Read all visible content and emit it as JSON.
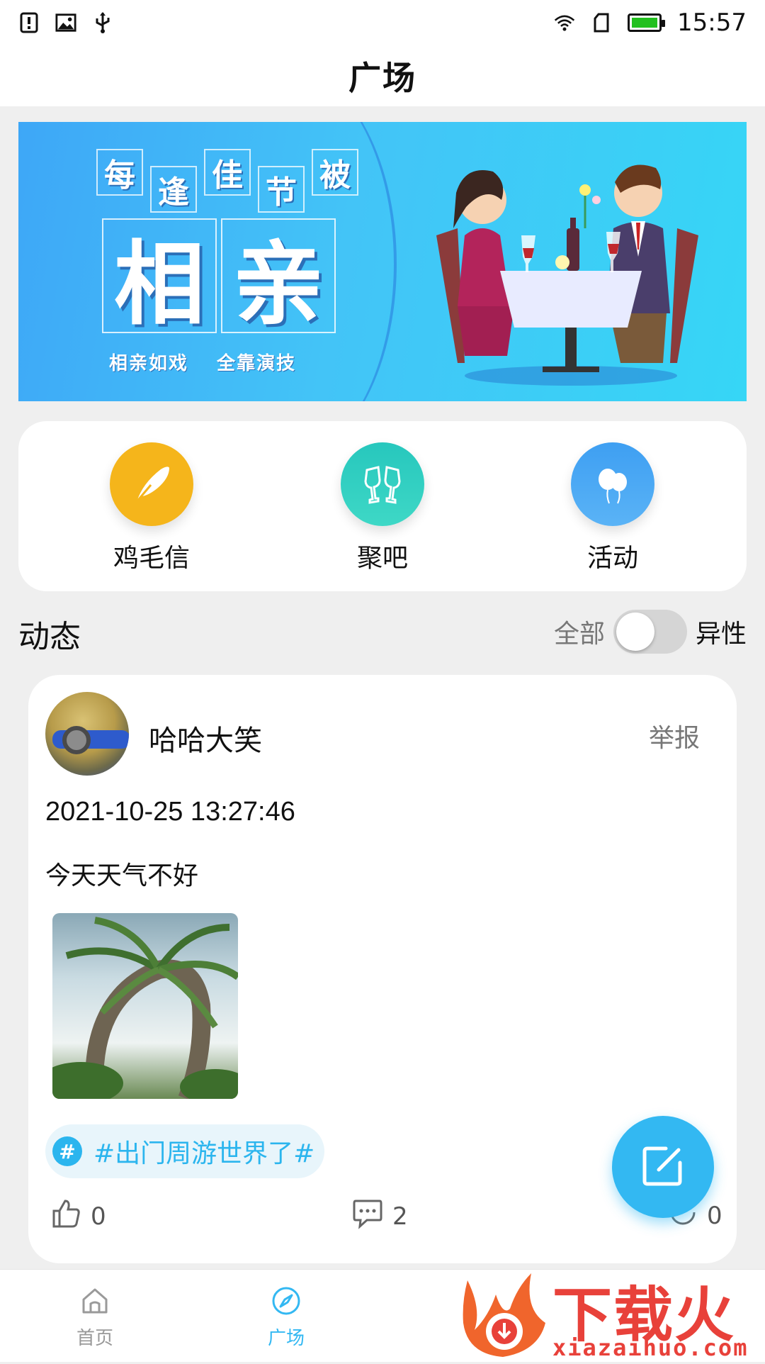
{
  "status_bar": {
    "time": "15:57"
  },
  "header": {
    "title": "广场"
  },
  "banner": {
    "top_chars": [
      "每",
      "逢",
      "佳",
      "节",
      "被"
    ],
    "main_chars": [
      "相",
      "亲"
    ],
    "subtitles": [
      "相亲如戏",
      "全靠演技"
    ]
  },
  "quick_menu": {
    "items": [
      {
        "label": "鸡毛信",
        "icon": "feather-icon",
        "color": "#f5b51b"
      },
      {
        "label": "聚吧",
        "icon": "cheers-glasses-icon",
        "color": "#2fd0c0"
      },
      {
        "label": "活动",
        "icon": "balloons-icon",
        "color": "#3aa0f2"
      }
    ]
  },
  "feed": {
    "section_title": "动态",
    "filter": {
      "left_label": "全部",
      "right_label": "异性",
      "toggle_on": false
    }
  },
  "post": {
    "username": "哈哈大笑",
    "report_label": "举报",
    "time": "2021-10-25 13:27:46",
    "text": "今天天气不好",
    "tag": "#出门周游世界了#",
    "likes": "0",
    "comments": "2",
    "shares": "0"
  },
  "tabbar": {
    "items": [
      {
        "label": "首页",
        "icon": "home-icon",
        "active": false
      },
      {
        "label": "广场",
        "icon": "compass-icon",
        "active": true
      }
    ],
    "active_color": "#33b8f2",
    "inactive_color": "#999999"
  },
  "watermark": {
    "brand": "下载火",
    "url": "xiazaihuo.com"
  }
}
